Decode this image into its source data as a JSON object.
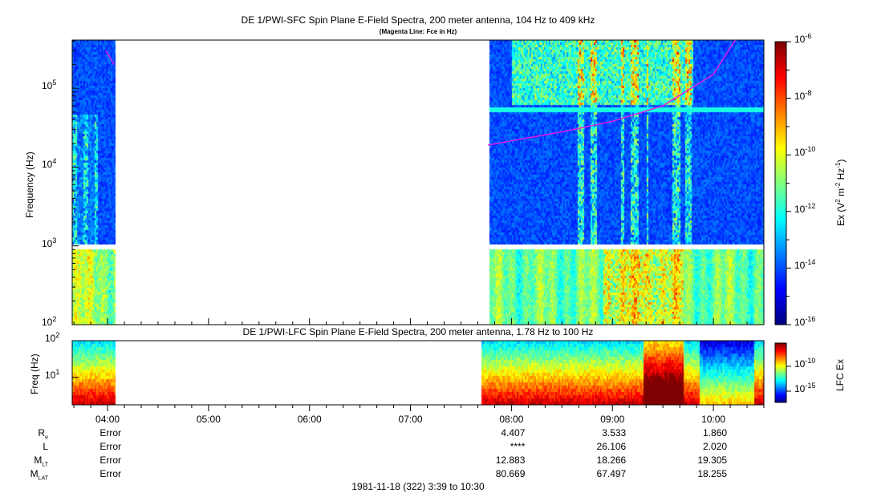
{
  "chart_data": [
    {
      "type": "heatmap",
      "title": "DE 1/PWI-SFC  Spin Plane E-Field Spectra, 200 meter antenna, 104 Hz to 409 kHz",
      "subtitle": "(Magenta Line: Fce in Hz)",
      "ylabel": "Frequency (Hz)",
      "yscale": "log",
      "ylim": [
        100,
        409000
      ],
      "yticks": [
        "10^2",
        "10^3",
        "10^4",
        "10^5"
      ],
      "colorbar_label": "Ex (V^2 m^-2 Hz^-1)",
      "colorbar_range": [
        1e-16,
        1e-06
      ],
      "colorbar_ticks": [
        "10^-6",
        "10^-8",
        "10^-10",
        "10^-12",
        "10^-14",
        "10^-16"
      ],
      "xlim": [
        "03:39",
        "10:30"
      ],
      "data_intervals": [
        [
          "03:39",
          "04:04"
        ],
        [
          "07:46",
          "10:30"
        ]
      ],
      "frequency_gap_hz": 1000,
      "fce_line": {
        "color": "#e020e0",
        "points": [
          [
            "03:59",
            300000
          ],
          [
            "04:04",
            200000
          ],
          [
            "07:46",
            19000
          ],
          [
            "08:30",
            28000
          ],
          [
            "09:00",
            38000
          ],
          [
            "09:30",
            60000
          ],
          [
            "10:00",
            150000
          ],
          [
            "10:13",
            409000
          ]
        ]
      }
    },
    {
      "type": "heatmap",
      "title": "DE 1/PWI-LFC  Spin Plane E-Field Spectra, 200 meter antenna, 1.78 Hz to 100 Hz",
      "ylabel": "Freq (Hz)",
      "yscale": "log",
      "ylim": [
        1.78,
        100
      ],
      "yticks": [
        "10^1",
        "10^2"
      ],
      "colorbar_label": "LFC Ex",
      "colorbar_ticks": [
        "10^-10",
        "10^-15"
      ],
      "xlim": [
        "03:39",
        "10:30"
      ],
      "data_intervals": [
        [
          "03:39",
          "04:04"
        ],
        [
          "07:42",
          "10:30"
        ]
      ]
    }
  ],
  "x_ticks": [
    "04:00",
    "05:00",
    "06:00",
    "07:00",
    "08:00",
    "09:00",
    "10:00"
  ],
  "ephemeris": {
    "rows": [
      {
        "label": "R",
        "sub": "e",
        "values": [
          "Error",
          "",
          "",
          "",
          "4.407",
          "3.533",
          "1.860"
        ]
      },
      {
        "label": "L",
        "sub": "",
        "values": [
          "Error",
          "",
          "",
          "",
          "****",
          "26.106",
          "2.020"
        ]
      },
      {
        "label": "M",
        "sub": "LT",
        "values": [
          "Error",
          "",
          "",
          "",
          "12.883",
          "18.266",
          "19.305"
        ]
      },
      {
        "label": "M",
        "sub": "LAT",
        "values": [
          "Error",
          "",
          "",
          "",
          "80.669",
          "67.497",
          "18.255"
        ]
      }
    ]
  },
  "footer": "1981-11-18 (322) 3:39 to 10:30"
}
